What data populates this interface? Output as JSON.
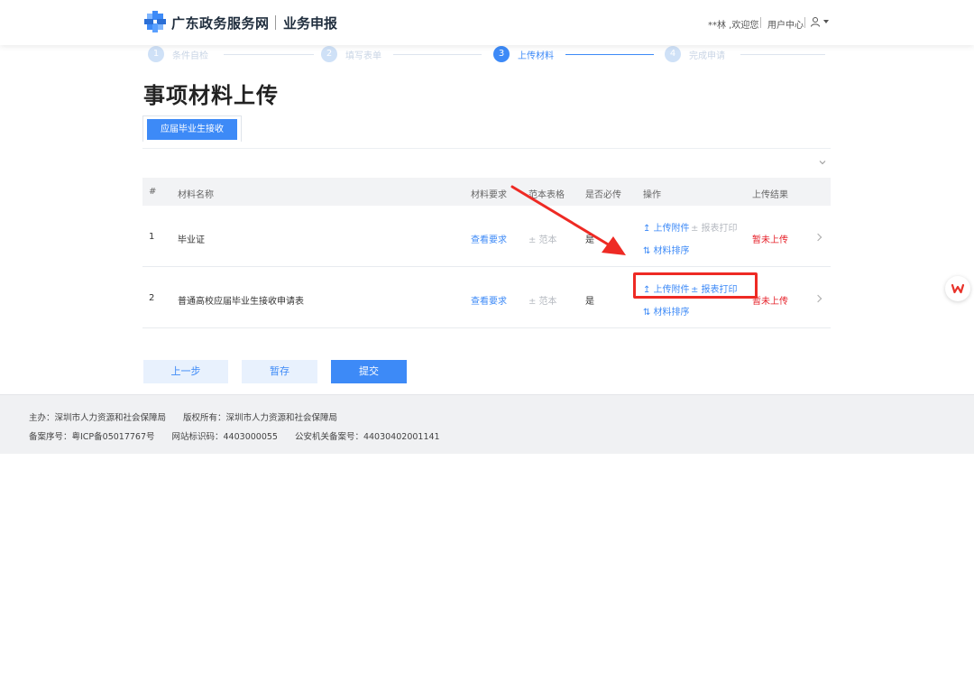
{
  "header": {
    "brand": "广东政务服务网",
    "sub": "业务申报",
    "welcome": "**林 ,欢迎您",
    "user_center": "用户中心",
    "icons": [
      "logo-icon",
      "user-icon",
      "caret-down-icon"
    ]
  },
  "steps": [
    {
      "num": "1",
      "label": "条件自检"
    },
    {
      "num": "2",
      "label": "填写表单"
    },
    {
      "num": "3",
      "label": "上传材料"
    },
    {
      "num": "4",
      "label": "完成申请"
    }
  ],
  "title": "事项材料上传",
  "tab": {
    "label": "应届毕业生接收"
  },
  "table": {
    "headers": [
      "#",
      "材料名称",
      "材料要求",
      "范本表格",
      "是否必传",
      "操作",
      "上传结果"
    ],
    "rows": [
      {
        "index": "1",
        "name": "毕业证",
        "requirement": "查看要求",
        "sample": "± 范本",
        "required": "是",
        "upload": "↥ 上传附件",
        "print": "± 报表打印",
        "sort": "⇅ 材料排序",
        "result": "暂未上传"
      },
      {
        "index": "2",
        "name": "普通高校应届毕业生接收申请表",
        "requirement": "查看要求",
        "sample": "± 范本",
        "required": "是",
        "upload": "↥ 上传附件",
        "print": "± 报表打印",
        "sort": "⇅ 材料排序",
        "result": "暂未上传"
      }
    ]
  },
  "buttons": {
    "prev": "上一步",
    "save": "暂存",
    "submit": "提交"
  },
  "footer": {
    "line1": "主办：深圳市人力资源和社会保障局　　版权所有：深圳市人力资源和社会保障局",
    "line2": "备案序号：粤ICP备05017767号　　网站标识码：4403000055　　公安机关备案号：44030402001141"
  },
  "colors": {
    "accent": "#3d8af7",
    "warning": "#e6212a",
    "annotation": "#ee2a24"
  }
}
